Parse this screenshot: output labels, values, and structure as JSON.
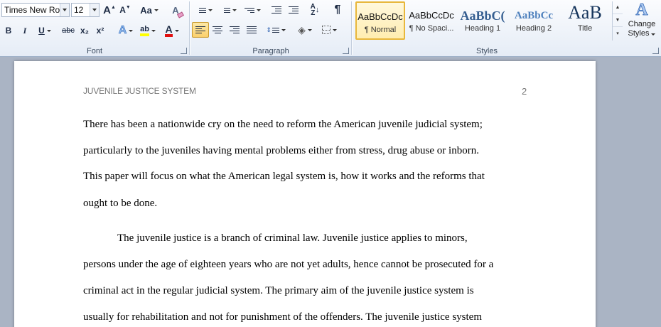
{
  "font_group": {
    "label": "Font",
    "font_name": "Times New Rom",
    "font_size": "12",
    "bold": "B",
    "italic": "I",
    "underline": "U",
    "strikethrough": "abc",
    "subscript": "x₂",
    "superscript": "x²",
    "grow_font": "A",
    "shrink_font": "A",
    "change_case": "Aa",
    "clear_formatting": "A",
    "text_effects": "A",
    "highlight": "ab",
    "font_color": "A"
  },
  "paragraph_group": {
    "label": "Paragraph",
    "pilcrow": "¶"
  },
  "styles_group": {
    "label": "Styles",
    "tiles": [
      {
        "sample": "AaBbCcDc",
        "name": "¶ Normal"
      },
      {
        "sample": "AaBbCcDc",
        "name": "¶ No Spaci..."
      },
      {
        "sample": "AaBbC(",
        "name": "Heading 1"
      },
      {
        "sample": "AaBbCc",
        "name": "Heading 2"
      },
      {
        "sample": "AaB",
        "name": "Title"
      }
    ],
    "change_styles": [
      "Change",
      "Styles"
    ]
  },
  "colors": {
    "heading_blue": "#365f91",
    "heading2_blue": "#4f81bd",
    "highlight_yellow": "#ffff00",
    "font_red": "#e01010",
    "selected_gold": "#e8b73b"
  },
  "document": {
    "header_title": "JUVENILE JUSTICE SYSTEM",
    "page_number": "2",
    "lines": [
      "There has been a nationwide cry on the need to reform the American juvenile judicial system;",
      "particularly to the juveniles having mental problems either from stress, drug abuse or inborn.",
      "This paper will focus on what the American legal system is, how it works and the reforms that",
      "ought to be done.",
      "The juvenile justice is a branch of criminal law. Juvenile justice applies to minors,",
      "persons under the age of eighteen years who are not yet adults, hence cannot be prosecuted for a",
      "criminal act in the regular judicial system. The primary aim of the juvenile justice system is",
      "usually for rehabilitation and not for punishment of the offenders. The juvenile justice system"
    ]
  }
}
